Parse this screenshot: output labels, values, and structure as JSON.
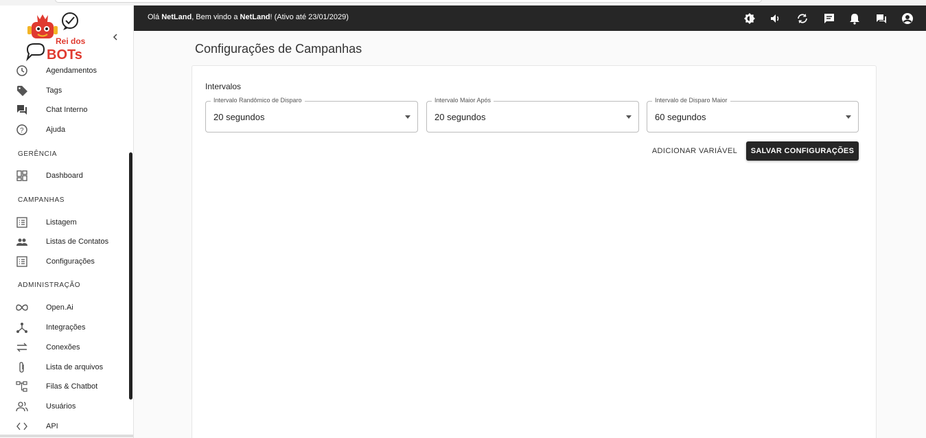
{
  "header": {
    "greeting_prefix": "Olá ",
    "user": "NetLand",
    "greeting_mid": ", Bem vindo a ",
    "company": "NetLand",
    "greeting_suffix": "! (Ativo até 23/01/2029)",
    "icons": [
      "theme-icon",
      "volume-icon",
      "refresh-icon",
      "message-icon",
      "notifications-icon",
      "chat-icon",
      "account-icon"
    ]
  },
  "logo": {
    "line1": "Rei dos",
    "line2": "BOTs"
  },
  "sidebar": {
    "items_top": [
      {
        "label": "Agendamentos",
        "icon": "clock-icon"
      },
      {
        "label": "Tags",
        "icon": "tag-icon"
      },
      {
        "label": "Chat Interno",
        "icon": "forum-icon"
      },
      {
        "label": "Ajuda",
        "icon": "help-icon"
      }
    ],
    "section_gerencia": "GERÊNCIA",
    "gerencia_items": [
      {
        "label": "Dashboard",
        "icon": "dashboard-icon"
      }
    ],
    "section_campanhas": "CAMPANHAS",
    "campanhas_items": [
      {
        "label": "Listagem",
        "icon": "list-icon"
      },
      {
        "label": "Listas de Contatos",
        "icon": "people-icon"
      },
      {
        "label": "Configurações",
        "icon": "list-icon"
      }
    ],
    "section_admin": "ADMINISTRAÇÃO",
    "admin_items": [
      {
        "label": "Open.Ai",
        "icon": "infinity-icon"
      },
      {
        "label": "Integrações",
        "icon": "hub-icon"
      },
      {
        "label": "Conexões",
        "icon": "swap-icon"
      },
      {
        "label": "Lista de arquivos",
        "icon": "attach-icon"
      },
      {
        "label": "Filas & Chatbot",
        "icon": "tree-icon"
      },
      {
        "label": "Usuários",
        "icon": "users-icon"
      },
      {
        "label": "API",
        "icon": "code-icon"
      }
    ]
  },
  "main": {
    "title": "Configurações de Campanhas",
    "intervals_label": "Intervalos",
    "selects": [
      {
        "label": "Intervalo Randômico de Disparo",
        "value": "20 segundos"
      },
      {
        "label": "Intervalo Maior Após",
        "value": "20 segundos"
      },
      {
        "label": "Intervalo de Disparo Maior",
        "value": "60 segundos"
      }
    ],
    "add_variable": "ADICIONAR VARIÁVEL",
    "save": "SALVAR CONFIGURAÇÕES"
  },
  "colors": {
    "topbar": "#262626",
    "primary_button": "#262626",
    "logo_red": "#e03a2f",
    "logo_yellow": "#f3b526"
  }
}
